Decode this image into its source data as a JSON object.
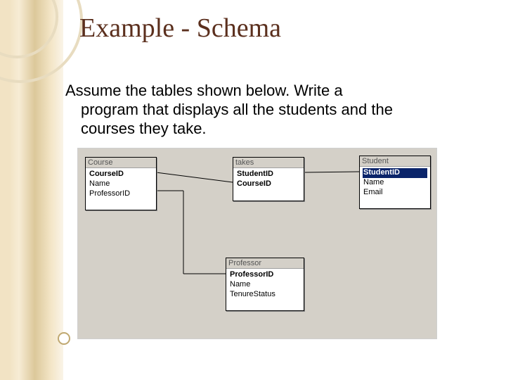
{
  "title": "Example - Schema",
  "body": {
    "line1": "Assume the tables shown below.  Write a",
    "line2": "program that displays all the students and the",
    "line3": "courses they take."
  },
  "tables": {
    "course": {
      "name": "Course",
      "fields": [
        "CourseID",
        "Name",
        "ProfessorID"
      ],
      "pk_indices": [
        0
      ]
    },
    "takes": {
      "name": "takes",
      "fields": [
        "StudentID",
        "CourseID"
      ],
      "pk_indices": [
        0,
        1
      ]
    },
    "student": {
      "name": "Student",
      "fields": [
        "StudentID",
        "Name",
        "Email"
      ],
      "pk_indices": [
        0
      ],
      "selected_index": 0
    },
    "professor": {
      "name": "Professor",
      "fields": [
        "ProfessorID",
        "Name",
        "TenureStatus"
      ],
      "pk_indices": [
        0
      ]
    }
  },
  "relationships": [
    {
      "from": "course.CourseID",
      "to": "takes.CourseID"
    },
    {
      "from": "takes.StudentID",
      "to": "student.StudentID"
    },
    {
      "from": "course.ProfessorID",
      "to": "professor.ProfessorID"
    }
  ]
}
